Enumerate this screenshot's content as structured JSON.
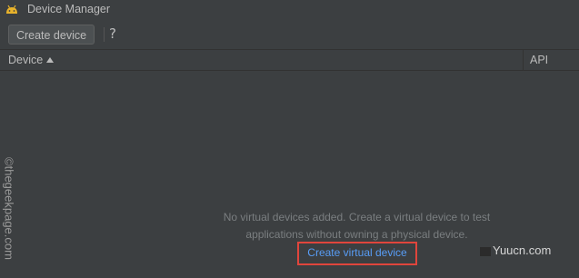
{
  "window": {
    "title": "Device Manager"
  },
  "toolbar": {
    "create_device_label": "Create device",
    "help_label": "?"
  },
  "table": {
    "columns": [
      {
        "label": "Device",
        "sort": "ascending"
      },
      {
        "label": "API"
      }
    ]
  },
  "empty_state": {
    "message": "No virtual devices added. Create a virtual device to test applications without owning a physical device.",
    "link_label": "Create virtual device"
  },
  "watermarks": {
    "left": "©thegeekpage.com",
    "right": "Yuucn.com"
  },
  "colors": {
    "background": "#3c3f41",
    "text": "#bbbbbb",
    "muted_text": "#7a7e80",
    "link": "#589df6",
    "highlight_box": "#e0453c",
    "android_icon": "#e8b32b"
  },
  "icons": {
    "app": "android-icon",
    "help": "help-icon",
    "sort": "sort-ascending-icon"
  }
}
